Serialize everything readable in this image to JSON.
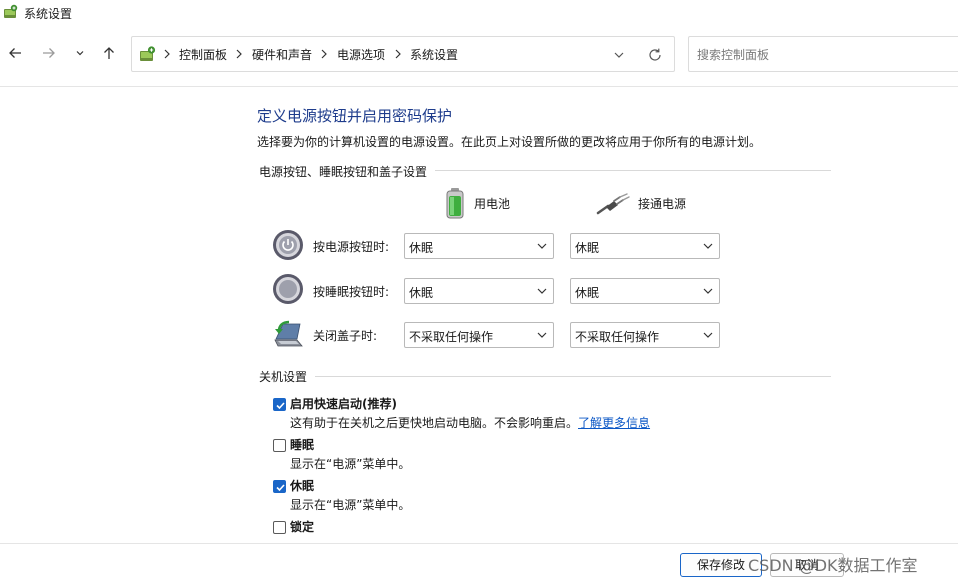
{
  "window": {
    "title": "系统设置",
    "icon": "control-panel-power-icon"
  },
  "nav": {
    "back_icon": "arrow-left-icon",
    "forward_icon": "arrow-right-icon",
    "recent_icon": "chevron-down-icon",
    "up_icon": "arrow-up-icon"
  },
  "address": {
    "breadcrumbs": [
      "控制面板",
      "硬件和声音",
      "电源选项",
      "系统设置"
    ],
    "dropdown_icon": "chevron-down-icon",
    "refresh_icon": "refresh-icon"
  },
  "search": {
    "placeholder": "搜索控制面板",
    "value": ""
  },
  "page": {
    "heading": "定义电源按钮并启用密码保护",
    "description": "选择要为你的计算机设置的电源设置。在此页上对设置所做的更改将应用于你所有的电源计划。"
  },
  "buttons_section": {
    "title": "电源按钮、睡眠按钮和盖子设置",
    "col_battery": "用电池",
    "col_plugged": "接通电源",
    "rows": [
      {
        "label": "按电源按钮时:",
        "icon": "power-button-icon",
        "battery": "休眠",
        "plugged": "休眠"
      },
      {
        "label": "按睡眠按钮时:",
        "icon": "sleep-button-icon",
        "battery": "休眠",
        "plugged": "休眠"
      },
      {
        "label": "关闭盖子时:",
        "icon": "laptop-lid-icon",
        "battery": "不采取任何操作",
        "plugged": "不采取任何操作"
      }
    ]
  },
  "shutdown_section": {
    "title": "关机设置",
    "items": [
      {
        "label": "启用快速启动(推荐)",
        "checked": true,
        "desc": "这有助于在关机之后更快地启动电脑。不会影响重启。",
        "link": "了解更多信息"
      },
      {
        "label": "睡眠",
        "checked": false,
        "desc": "显示在“电源”菜单中。"
      },
      {
        "label": "休眠",
        "checked": true,
        "desc": "显示在“电源”菜单中。"
      },
      {
        "label": "锁定",
        "checked": false,
        "desc": ""
      }
    ]
  },
  "footer": {
    "save_label": "保存修改",
    "cancel_label": "取消"
  },
  "watermark": "CSDN @DK数据工作室",
  "colors": {
    "heading": "#1e3c8c",
    "accent": "#1a66c8",
    "link": "#0b57c6"
  }
}
